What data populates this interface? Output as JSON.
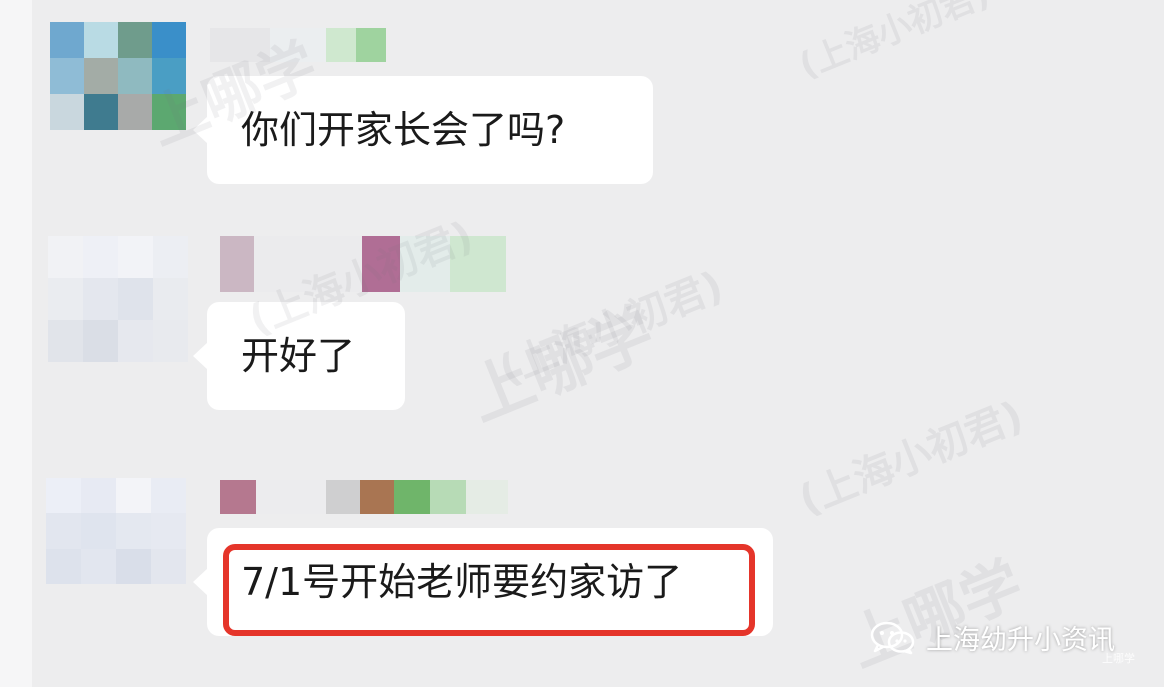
{
  "messages": [
    {
      "text": "你们开家长会了吗?"
    },
    {
      "text": "开好了"
    },
    {
      "text": "7/1号开始老师要约家访了"
    }
  ],
  "watermarks": {
    "mark": "上哪学",
    "account": "(上海小初君)"
  },
  "brand": {
    "account_name": "上海幼升小资讯",
    "small_mark": "上哪学",
    "icon": "wechat-icon"
  },
  "colors": {
    "background": "#ededee",
    "bubble": "#ffffff",
    "highlight": "#e5352a"
  }
}
